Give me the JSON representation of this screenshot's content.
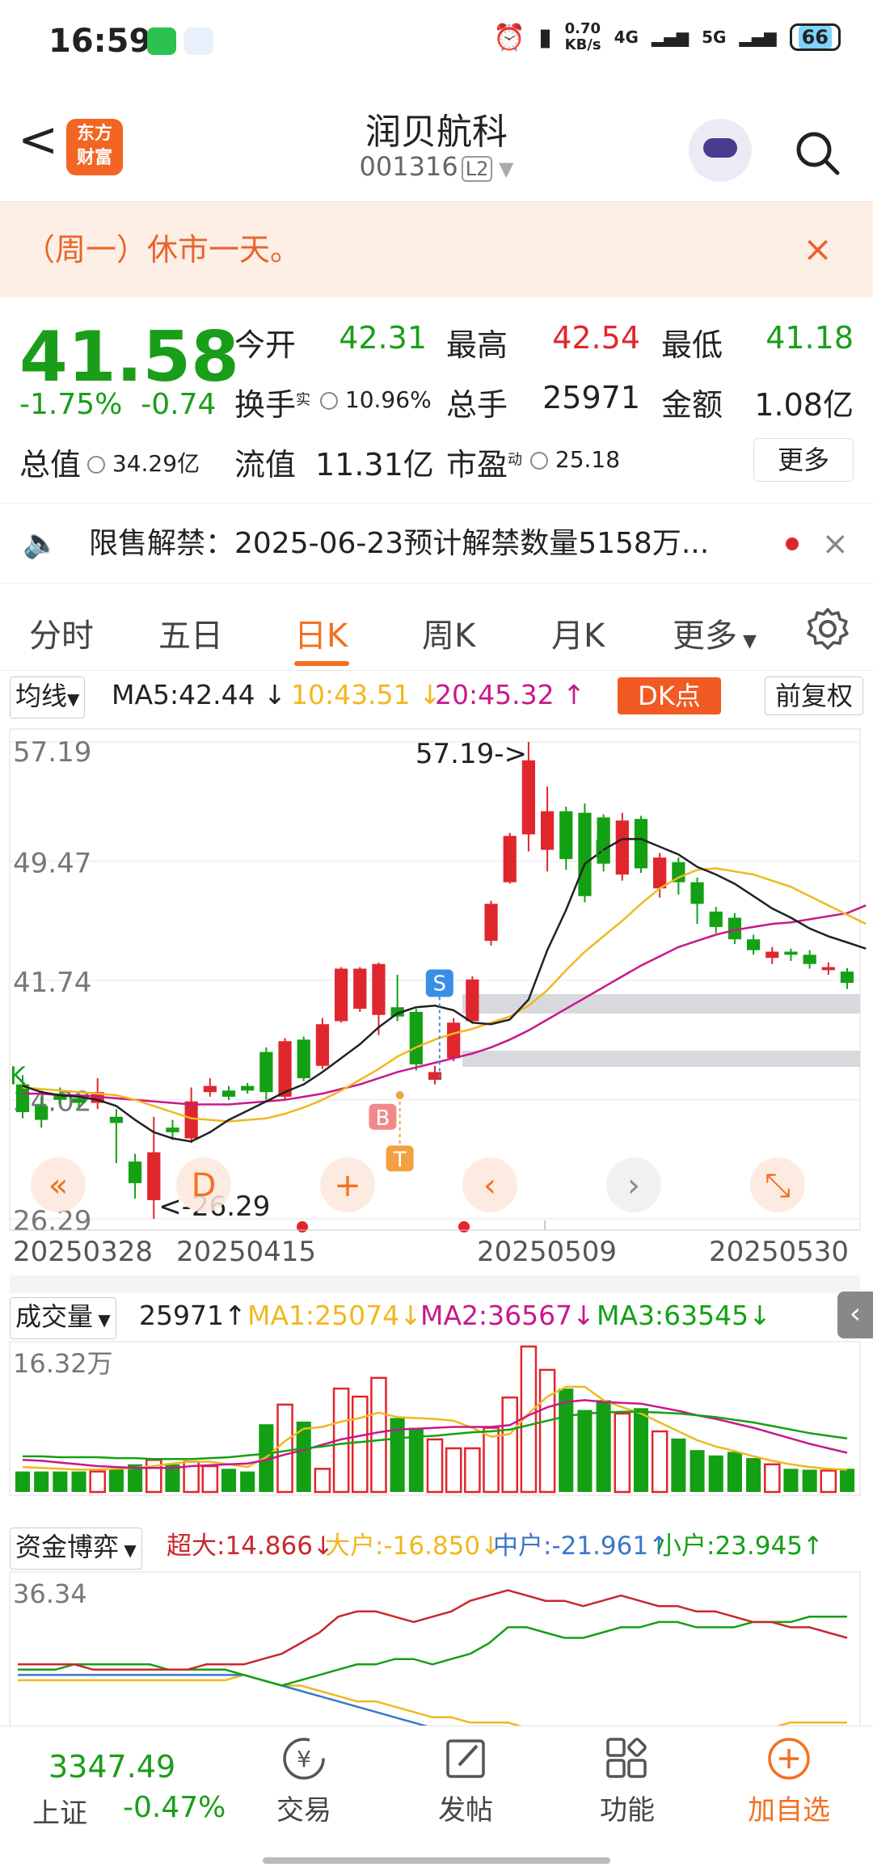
{
  "status": {
    "time": "16:59",
    "speed_num": "0.70",
    "speed_unit": "KB/s",
    "net1": "4G",
    "net2": "5G",
    "battery": "66"
  },
  "header": {
    "back": "<",
    "logo_line1": "东方",
    "logo_line2": "财富",
    "title": "润贝航科",
    "code": "001316",
    "level": "L2"
  },
  "notice": {
    "text": "（周一）休市一天。",
    "close": "×"
  },
  "quote": {
    "price": "41.58",
    "pct": "-1.75%",
    "change": "-0.74",
    "open_label": "今开",
    "open": "42.31",
    "high_label": "最高",
    "high": "42.54",
    "low_label": "最低",
    "low": "41.18",
    "turnover_label": "换手",
    "turnover_sup": "实",
    "turnover": "10.96%",
    "vol_label": "总手",
    "vol": "25971",
    "amount_label": "金额",
    "amount": "1.08亿",
    "mcap_label": "总值",
    "mcap": "34.29亿",
    "float_label": "流值",
    "float": "11.31亿",
    "pe_label": "市盈",
    "pe_sup": "动",
    "pe": "25.18",
    "more": "更多"
  },
  "unlock": {
    "text": "限售解禁：2025-06-23预计解禁数量5158万...",
    "close": "×"
  },
  "tabs": [
    "分时",
    "五日",
    "日K",
    "周K",
    "月K",
    "更多"
  ],
  "active_tab": "日K",
  "ma_bar": {
    "selector": "均线",
    "ma5": "MA5:42.44 ↓",
    "ma10": "10:43.51 ↓",
    "ma20": "20:45.32 ↑",
    "dk": "DK点",
    "fq": "前复权"
  },
  "kline": {
    "y_labels": [
      "57.19",
      "49.47",
      "41.74",
      "34.02",
      "26.29"
    ],
    "x_labels": [
      "20250328",
      "20250415",
      "20250509",
      "20250530"
    ],
    "max_label": "57.19->",
    "min_label": "<-26.29",
    "markers": {
      "k1": "K",
      "k2": "K",
      "s": "S",
      "b": "B",
      "t": "T",
      "d": "D"
    },
    "colors": {
      "up": "#e0262d",
      "down": "#14a014",
      "ma5": "#222222",
      "ma10": "#f0b820",
      "ma20": "#c8188c"
    }
  },
  "chart_data": {
    "type": "candlestick",
    "ylim": [
      26.29,
      57.19
    ],
    "candles": [
      {
        "o": 35.0,
        "c": 33.2,
        "h": 35.6,
        "l": 32.8
      },
      {
        "o": 33.6,
        "c": 32.7,
        "h": 34.2,
        "l": 32.2
      },
      {
        "o": 34.4,
        "c": 34.0,
        "h": 34.8,
        "l": 33.7
      },
      {
        "o": 34.1,
        "c": 33.8,
        "h": 34.5,
        "l": 33.5
      },
      {
        "o": 33.8,
        "c": 34.5,
        "h": 35.4,
        "l": 33.4
      },
      {
        "o": 32.9,
        "c": 32.5,
        "h": 33.4,
        "l": 29.9
      },
      {
        "o": 30.0,
        "c": 28.6,
        "h": 30.5,
        "l": 27.6
      },
      {
        "o": 27.5,
        "c": 30.6,
        "h": 32.9,
        "l": 26.29
      },
      {
        "o": 32.2,
        "c": 31.9,
        "h": 32.7,
        "l": 31.4
      },
      {
        "o": 31.5,
        "c": 33.9,
        "h": 34.8,
        "l": 31.2
      },
      {
        "o": 34.5,
        "c": 34.9,
        "h": 35.4,
        "l": 34.2
      },
      {
        "o": 34.6,
        "c": 34.2,
        "h": 34.9,
        "l": 34.0
      },
      {
        "o": 34.9,
        "c": 34.6,
        "h": 35.1,
        "l": 34.4
      },
      {
        "o": 37.1,
        "c": 34.5,
        "h": 37.4,
        "l": 34.0
      },
      {
        "o": 34.2,
        "c": 37.8,
        "h": 38.0,
        "l": 34.0
      },
      {
        "o": 37.9,
        "c": 35.4,
        "h": 38.1,
        "l": 35.2
      },
      {
        "o": 36.2,
        "c": 38.9,
        "h": 39.3,
        "l": 36.0
      },
      {
        "o": 39.1,
        "c": 42.5,
        "h": 42.6,
        "l": 39.0
      },
      {
        "o": 39.9,
        "c": 42.5,
        "h": 42.6,
        "l": 39.7
      },
      {
        "o": 39.5,
        "c": 42.8,
        "h": 42.9,
        "l": 38.2
      },
      {
        "o": 40.0,
        "c": 39.4,
        "h": 42.1,
        "l": 39.1
      },
      {
        "o": 39.7,
        "c": 36.3,
        "h": 39.9,
        "l": 35.9
      },
      {
        "o": 35.3,
        "c": 35.8,
        "h": 36.2,
        "l": 35.0
      },
      {
        "o": 36.7,
        "c": 39.0,
        "h": 39.3,
        "l": 36.5
      },
      {
        "o": 39.1,
        "c": 41.8,
        "h": 42.0,
        "l": 39.0
      },
      {
        "o": 44.3,
        "c": 46.7,
        "h": 46.9,
        "l": 44.0
      },
      {
        "o": 48.1,
        "c": 51.1,
        "h": 51.3,
        "l": 48.0
      },
      {
        "o": 51.2,
        "c": 56.0,
        "h": 57.19,
        "l": 50.1
      },
      {
        "o": 50.2,
        "c": 52.7,
        "h": 54.3,
        "l": 48.8
      },
      {
        "o": 52.7,
        "c": 49.6,
        "h": 53.0,
        "l": 48.9
      },
      {
        "o": 52.6,
        "c": 47.2,
        "h": 53.2,
        "l": 46.8
      },
      {
        "o": 52.3,
        "c": 49.3,
        "h": 52.5,
        "l": 48.8
      },
      {
        "o": 48.6,
        "c": 52.1,
        "h": 52.6,
        "l": 48.2
      },
      {
        "o": 52.2,
        "c": 49.0,
        "h": 52.4,
        "l": 48.7
      },
      {
        "o": 47.7,
        "c": 49.7,
        "h": 50.0,
        "l": 47.1
      },
      {
        "o": 49.4,
        "c": 48.1,
        "h": 49.7,
        "l": 47.3
      },
      {
        "o": 48.1,
        "c": 46.7,
        "h": 48.4,
        "l": 45.4
      },
      {
        "o": 46.2,
        "c": 45.2,
        "h": 46.5,
        "l": 44.8
      },
      {
        "o": 45.8,
        "c": 44.4,
        "h": 46.1,
        "l": 44.1
      },
      {
        "o": 44.4,
        "c": 43.7,
        "h": 44.7,
        "l": 43.4
      },
      {
        "o": 43.2,
        "c": 43.6,
        "h": 43.9,
        "l": 42.8
      },
      {
        "o": 43.6,
        "c": 43.4,
        "h": 43.8,
        "l": 43.0
      },
      {
        "o": 43.4,
        "c": 42.8,
        "h": 43.7,
        "l": 42.5
      },
      {
        "o": 42.4,
        "c": 42.6,
        "h": 42.9,
        "l": 42.1
      },
      {
        "o": 42.31,
        "c": 41.58,
        "h": 42.54,
        "l": 41.18
      }
    ],
    "ma5": [
      34.9,
      34.5,
      34.3,
      34.2,
      34.0,
      33.6,
      32.7,
      31.9,
      31.5,
      31.3,
      31.9,
      32.7,
      33.3,
      33.9,
      34.5,
      35.0,
      35.8,
      36.7,
      37.6,
      38.7,
      39.6,
      40.0,
      40.1,
      39.8,
      39.0,
      38.9,
      39.2,
      40.5,
      43.7,
      46.3,
      49.3,
      50.2,
      50.9,
      50.9,
      50.4,
      49.9,
      49.1,
      48.6,
      48.0,
      47.2,
      46.4,
      45.8,
      45.1,
      44.6,
      44.2,
      43.8
    ],
    "ma10": [
      34.8,
      34.7,
      34.6,
      34.5,
      34.4,
      34.3,
      34.0,
      33.6,
      33.2,
      32.8,
      32.7,
      32.6,
      32.7,
      32.8,
      33.1,
      33.5,
      34.0,
      34.6,
      35.3,
      36.0,
      36.8,
      37.4,
      37.9,
      38.3,
      38.6,
      39.0,
      39.4,
      40.1,
      41.1,
      42.4,
      43.6,
      44.6,
      45.6,
      46.7,
      47.7,
      48.4,
      48.9,
      49.0,
      48.8,
      48.6,
      48.2,
      47.8,
      47.2,
      46.6,
      46.0,
      45.4
    ],
    "ma20": [
      34.4,
      34.4,
      34.3,
      34.3,
      34.2,
      34.1,
      34.0,
      33.9,
      33.8,
      33.7,
      33.7,
      33.7,
      33.8,
      33.9,
      34.0,
      34.2,
      34.4,
      34.7,
      35.0,
      35.4,
      35.8,
      36.1,
      36.4,
      36.7,
      37.0,
      37.4,
      37.9,
      38.5,
      39.2,
      39.9,
      40.6,
      41.3,
      42.0,
      42.7,
      43.3,
      43.9,
      44.3,
      44.7,
      45.0,
      45.2,
      45.4,
      45.5,
      45.7,
      45.9,
      46.1,
      46.6
    ],
    "volume": {
      "ylim": [
        0,
        16.32
      ],
      "unit": "万",
      "y_label": "16.32万",
      "values": [
        2.3,
        2.3,
        2.3,
        2.3,
        2.3,
        2.6,
        3.1,
        3.6,
        3.1,
        3.4,
        2.9,
        2.6,
        2.3,
        7.6,
        9.8,
        7.9,
        2.6,
        11.6,
        10.7,
        12.8,
        8.3,
        7.2,
        5.9,
        4.9,
        4.9,
        7.2,
        10.6,
        16.32,
        13.7,
        11.6,
        9.2,
        10.3,
        8.8,
        9.4,
        6.8,
        6.0,
        4.7,
        4.1,
        4.5,
        3.8,
        3.1,
        2.6,
        2.5,
        2.4,
        2.6
      ],
      "ma1": [
        2.8,
        2.7,
        2.6,
        2.5,
        2.5,
        2.6,
        2.7,
        2.9,
        3.2,
        3.4,
        3.4,
        3.1,
        2.8,
        3.9,
        5.7,
        7.1,
        7.3,
        7.9,
        8.3,
        8.9,
        8.4,
        8.3,
        8.2,
        8.0,
        7.2,
        6.2,
        6.5,
        8.8,
        10.7,
        11.8,
        11.8,
        10.3,
        9.5,
        8.8,
        7.8,
        6.8,
        5.8,
        5.1,
        4.6,
        4.0,
        3.5,
        3.1,
        2.8,
        2.6,
        2.5
      ],
      "ma2": [
        3.6,
        3.5,
        3.3,
        3.1,
        2.9,
        2.8,
        2.7,
        2.7,
        2.7,
        2.9,
        3.0,
        3.1,
        3.2,
        3.6,
        4.2,
        4.7,
        5.3,
        5.9,
        6.3,
        6.7,
        7.0,
        7.1,
        7.2,
        7.3,
        7.3,
        7.3,
        7.5,
        8.6,
        9.5,
        10.1,
        10.3,
        10.1,
        10.0,
        9.9,
        9.5,
        9.1,
        8.6,
        8.2,
        7.7,
        7.2,
        6.6,
        6.0,
        5.4,
        4.9,
        4.4
      ],
      "ma3": [
        4.0,
        4.0,
        3.9,
        3.9,
        3.9,
        3.8,
        3.8,
        3.7,
        3.7,
        3.7,
        3.8,
        3.9,
        4.1,
        4.3,
        4.6,
        4.9,
        5.1,
        5.4,
        5.6,
        5.8,
        6.0,
        6.2,
        6.3,
        6.5,
        6.7,
        6.8,
        7.0,
        7.5,
        8.0,
        8.5,
        8.8,
        8.9,
        9.0,
        9.0,
        8.9,
        8.8,
        8.6,
        8.4,
        8.1,
        7.8,
        7.4,
        7.0,
        6.6,
        6.3,
        6.0
      ]
    },
    "fund_flow": {
      "y_label": "36.34",
      "super": [
        22,
        22,
        22,
        22,
        21,
        21,
        21,
        21,
        21,
        21,
        22,
        22,
        22,
        23,
        24,
        26,
        28,
        31,
        32,
        32,
        31,
        30,
        31,
        32,
        34,
        35,
        36,
        35,
        34,
        34,
        33,
        34,
        35,
        34,
        33,
        33,
        32,
        32,
        31,
        30,
        30,
        29,
        29,
        28,
        27
      ],
      "big": [
        19,
        19,
        19,
        19,
        19,
        19,
        19,
        19,
        19,
        19,
        19,
        19,
        20,
        19,
        18,
        18,
        17,
        16,
        15,
        15,
        14,
        13,
        12,
        12,
        11,
        11,
        11,
        10,
        10,
        10,
        10,
        10,
        10,
        10,
        10,
        10,
        10,
        10,
        10,
        10,
        10,
        11,
        11,
        11,
        11
      ],
      "mid": [
        20,
        20,
        20,
        20,
        20,
        20,
        20,
        20,
        20,
        20,
        20,
        20,
        20,
        19,
        18,
        17,
        16,
        15,
        14,
        13,
        12,
        11,
        10,
        9,
        9,
        9,
        9,
        9,
        9,
        9,
        9,
        9,
        9,
        9,
        9,
        9,
        9,
        9,
        9,
        9,
        9,
        9,
        9,
        9,
        9
      ],
      "small": [
        21,
        21,
        21,
        22,
        22,
        22,
        22,
        22,
        21,
        21,
        21,
        21,
        20,
        19,
        18,
        19,
        20,
        21,
        22,
        22,
        23,
        23,
        22,
        23,
        24,
        26,
        29,
        29,
        28,
        27,
        27,
        28,
        29,
        29,
        30,
        30,
        29,
        29,
        29,
        30,
        30,
        30,
        31,
        31,
        31
      ]
    }
  },
  "vol_bar": {
    "selector": "成交量",
    "cur": "25971↑",
    "ma1": "MA1:25074↓",
    "ma2": "MA2:36567↓",
    "ma3": "MA3:63545↓"
  },
  "fund_bar": {
    "selector": "资金博弈",
    "super": "超大:14.866↓",
    "big": "大户:-16.850↓",
    "mid": "中户:-21.961↑",
    "small": "小户:23.945↑"
  },
  "bottom": {
    "index_val": "3347.49",
    "index_name": "上证",
    "index_pct": "-0.47%",
    "trade": "交易",
    "post": "发帖",
    "func": "功能",
    "fav": "加自选"
  }
}
